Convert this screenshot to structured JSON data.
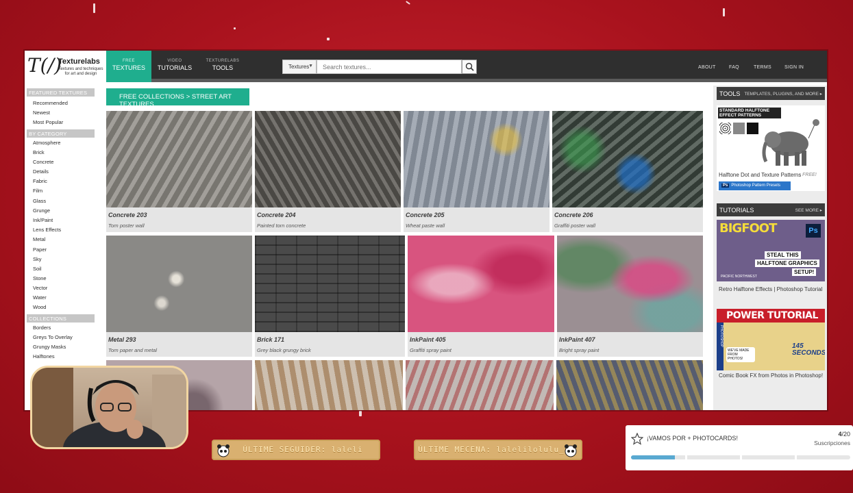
{
  "site": {
    "logo_mark": "T(/)",
    "logo_name": "Texturelabs",
    "logo_tagline": "Textures and techniques for art and design",
    "nav_tabs": [
      {
        "small": "FREE",
        "big": "TEXTURES"
      },
      {
        "small": "VIDEO",
        "big": "TUTORIALS"
      },
      {
        "small": "TEXTURELABS",
        "big": "TOOLS"
      }
    ],
    "search": {
      "select_value": "Textures",
      "placeholder": "Search textures..."
    },
    "top_links": [
      "ABOUT",
      "FAQ",
      "TERMS",
      "SIGN IN"
    ]
  },
  "sidebar": {
    "featured_head": "FEATURED TEXTURES",
    "featured": [
      "Recommended",
      "Newest",
      "Most Popular"
    ],
    "category_head": "BY CATEGORY",
    "categories": [
      "Atmosphere",
      "Brick",
      "Concrete",
      "Details",
      "Fabric",
      "Film",
      "Glass",
      "Grunge",
      "Ink/Paint",
      "Lens Effects",
      "Metal",
      "Paper",
      "Sky",
      "Soil",
      "Stone",
      "Vector",
      "Water",
      "Wood"
    ],
    "collections_head": "COLLECTIONS",
    "collections": [
      "Borders",
      "Greys To Overlay",
      "Grungy Masks",
      "Halftones"
    ]
  },
  "main": {
    "breadcrumb": "FREE COLLECTIONS > STREET ART TEXTURES",
    "cards": [
      {
        "title": "Concrete 203",
        "subtitle": "Torn poster wall",
        "color": "#8d8a84"
      },
      {
        "title": "Concrete 204",
        "subtitle": "Painted torn concrete",
        "color": "#5d5a55"
      },
      {
        "title": "Concrete 205",
        "subtitle": "Wheat paste wall",
        "color": "#8f97a4"
      },
      {
        "title": "Concrete 206",
        "subtitle": "Graffiti poster wall",
        "color": "#3e4a42"
      },
      {
        "title": "Metal 293",
        "subtitle": "Torn paper and metal",
        "color": "#8a8986"
      },
      {
        "title": "Brick 171",
        "subtitle": "Grey black grungy brick",
        "color": "#4a4a4a"
      },
      {
        "title": "InkPaint 405",
        "subtitle": "Graffiti spray paint",
        "color": "#d8547f"
      },
      {
        "title": "InkPaint 407",
        "subtitle": "Bright spray paint",
        "color": "#9b8f93"
      },
      {
        "title": "",
        "subtitle": "",
        "color": "#b5a4a8"
      },
      {
        "title": "",
        "subtitle": "",
        "color": "#b7a48d"
      },
      {
        "title": "",
        "subtitle": "",
        "color": "#a89b95"
      },
      {
        "title": "",
        "subtitle": "",
        "color": "#6f6e6a"
      }
    ]
  },
  "right": {
    "tools_head": "TOOLS",
    "tools_more": "TEMPLATES, PLUGINS, AND MORE ▸",
    "halftone_title": "STANDARD HALFTONE EFFECT PATTERNS",
    "free_badge": "FREE!",
    "tools_caption": "Halftone Dot and Texture Patterns",
    "ps_badge": "Ps",
    "ps_label": "Photoshop Pattern Presets",
    "tutorials_head": "TUTORIALS",
    "tutorials_more": "SEE MORE ▸",
    "tut1": {
      "top": "BIGFOOT",
      "ps": "Ps",
      "line1": "STEAL THIS",
      "line2": "HALFTONE GRAPHICS",
      "line3": "SETUP!",
      "foot": "PACIFIC NORTHWEST",
      "caption": "Retro Halftone Effects | Photoshop Tutorial"
    },
    "tut2": {
      "top": "POWER TUTORIAL",
      "side": "PHOTOSHOP",
      "bubble": "WE'VE MADE FROM PHOTOS!",
      "seconds": "145 SECONDS!",
      "caption": "Comic Book FX from Photos in Photoshop!"
    }
  },
  "overlay": {
    "follower": "ÚLTIME SEGUIDER: laleli",
    "patron": "ÚLTIME MECENA: lalelilolulu_",
    "goal_title": "¡VAMOS POR + PHOTOCARDS!",
    "goal_current": "4",
    "goal_total": "/20",
    "goal_label": "Suscripciones",
    "goal_progress": 0.2,
    "accent": "#59a9d1",
    "brand_green": "#1fae8e"
  }
}
